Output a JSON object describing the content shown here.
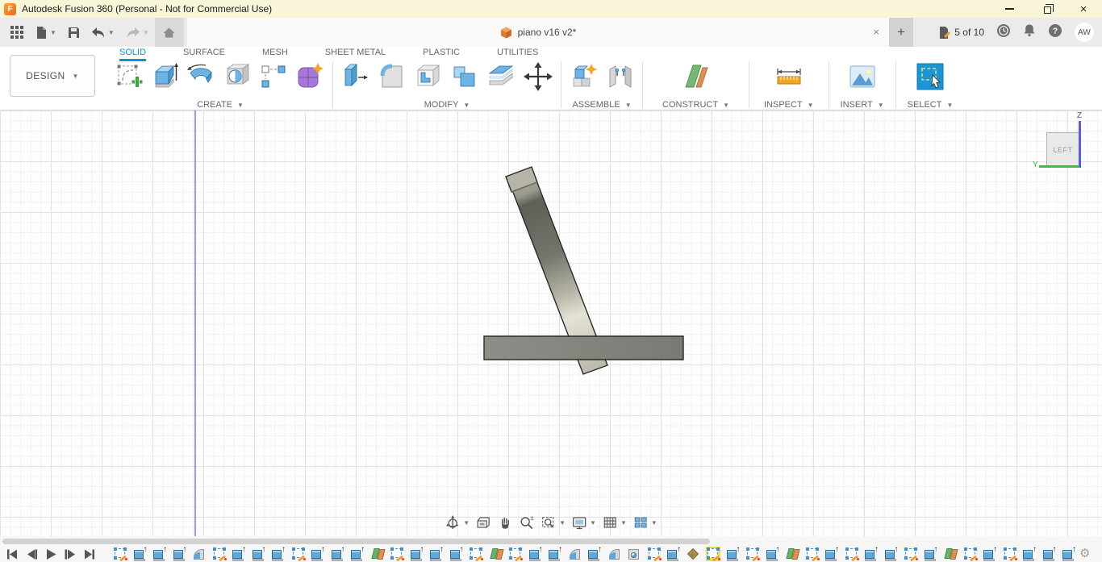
{
  "window": {
    "title": "Autodesk Fusion 360 (Personal - Not for Commercial Use)",
    "controls": [
      "minimize",
      "restore",
      "close"
    ]
  },
  "topbar": {
    "left_icons": [
      "app-grid",
      "file-new",
      "save",
      "undo",
      "redo",
      "home"
    ],
    "document_tab": {
      "label": "piano v16 v2*",
      "icon": "orange-cube",
      "close_glyph": "×"
    },
    "new_tab_glyph": "+",
    "job_status": {
      "label": "5 of 10",
      "icon": "job-document-pencil"
    },
    "right_icons": [
      "clock",
      "notifications",
      "help"
    ],
    "avatar": {
      "initials": "AW"
    }
  },
  "ribbon": {
    "workspace_selector": {
      "label": "DESIGN"
    },
    "tabs": [
      {
        "label": "SOLID",
        "active": true
      },
      {
        "label": "SURFACE",
        "active": false
      },
      {
        "label": "MESH",
        "active": false
      },
      {
        "label": "SHEET METAL",
        "active": false
      },
      {
        "label": "PLASTIC",
        "active": false
      },
      {
        "label": "UTILITIES",
        "active": false
      }
    ],
    "groups": [
      {
        "label": "CREATE",
        "dropdown": true,
        "tools": [
          "create-sketch",
          "extrude",
          "revolve",
          "hole",
          "rectangular-pattern",
          "create-form"
        ]
      },
      {
        "label": "MODIFY",
        "dropdown": true,
        "tools": [
          "press-pull",
          "fillet",
          "shell",
          "combine",
          "split-body",
          "move"
        ]
      },
      {
        "label": "ASSEMBLE",
        "dropdown": true,
        "tools": [
          "new-component",
          "joint"
        ]
      },
      {
        "label": "CONSTRUCT",
        "dropdown": true,
        "tools": [
          "construct-plane"
        ]
      },
      {
        "label": "INSPECT",
        "dropdown": true,
        "tools": [
          "measure"
        ]
      },
      {
        "label": "INSERT",
        "dropdown": true,
        "tools": [
          "insert-image"
        ]
      },
      {
        "label": "SELECT",
        "dropdown": true,
        "tools": [
          "select"
        ]
      }
    ]
  },
  "canvas": {
    "viewcube": {
      "face": "LEFT",
      "axis_vertical": "Z",
      "axis_horizontal": "Y"
    },
    "navbar_icons": [
      "orbit",
      "look-at",
      "pan",
      "zoom",
      "fit",
      "display-settings",
      "grid-settings",
      "viewports"
    ]
  },
  "timeline": {
    "playback": [
      "skip-start",
      "step-back",
      "play",
      "step-forward",
      "skip-end"
    ],
    "selected_index": 30,
    "icons": [
      "sketch",
      "extrude",
      "extrude",
      "extrude",
      "fillet",
      "sketch",
      "extrude",
      "extrude",
      "extrude",
      "sketch",
      "extrude",
      "extrude",
      "extrude",
      "plane",
      "sketch",
      "extrude",
      "extrude",
      "extrude",
      "sketch",
      "plane",
      "sketch",
      "extrude",
      "extrude",
      "fillet",
      "extrude",
      "fillet",
      "hole",
      "sketch",
      "extrude",
      "appearance",
      "sketch",
      "extrude",
      "sketch",
      "extrude",
      "plane",
      "sketch",
      "extrude",
      "sketch",
      "extrude",
      "extrude",
      "sketch",
      "extrude",
      "plane",
      "sketch",
      "extrude",
      "sketch",
      "extrude",
      "extrude",
      "extrude"
    ],
    "settings_icon": "gear",
    "gear_glyph": "⚙"
  },
  "colors": {
    "titlebar_yellow": "#f9f5d8",
    "accent_blue": "#0a96d6",
    "select_tile_blue": "#1b95d6",
    "highlight_yellow": "#e6e04a",
    "axis_z_blue": "#5a5ae8",
    "axis_y_green": "#38c438"
  }
}
